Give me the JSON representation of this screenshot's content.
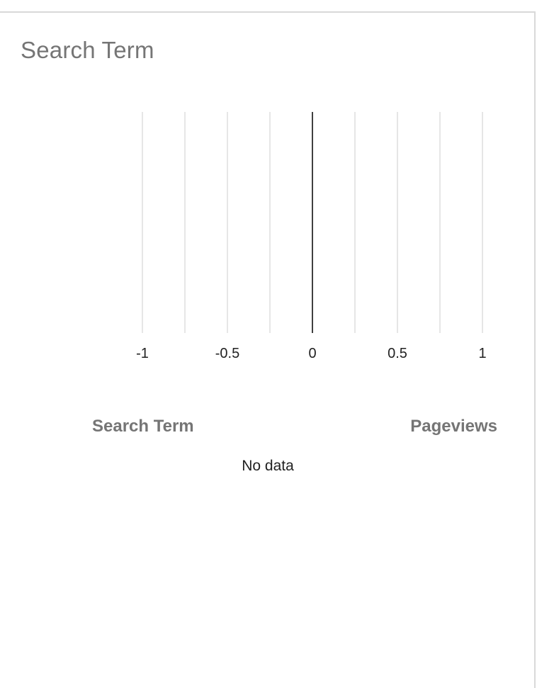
{
  "card": {
    "title": "Search Term"
  },
  "chart_data": {
    "type": "bar",
    "orientation": "horizontal",
    "categories": [],
    "series": [],
    "xlim": [
      -1,
      1
    ],
    "x_ticks": [
      -1,
      -0.5,
      0,
      0.5,
      1
    ],
    "x_tick_labels": [
      "-1",
      "-0.5",
      "0",
      "0.5",
      "1"
    ],
    "gridline_step": 0.25,
    "grid": true,
    "zero_line_color": "#000000",
    "grid_color": "#cccccc"
  },
  "table": {
    "columns": [
      "Search Term",
      "Pageviews"
    ],
    "rows": [],
    "empty_message": "No data"
  }
}
